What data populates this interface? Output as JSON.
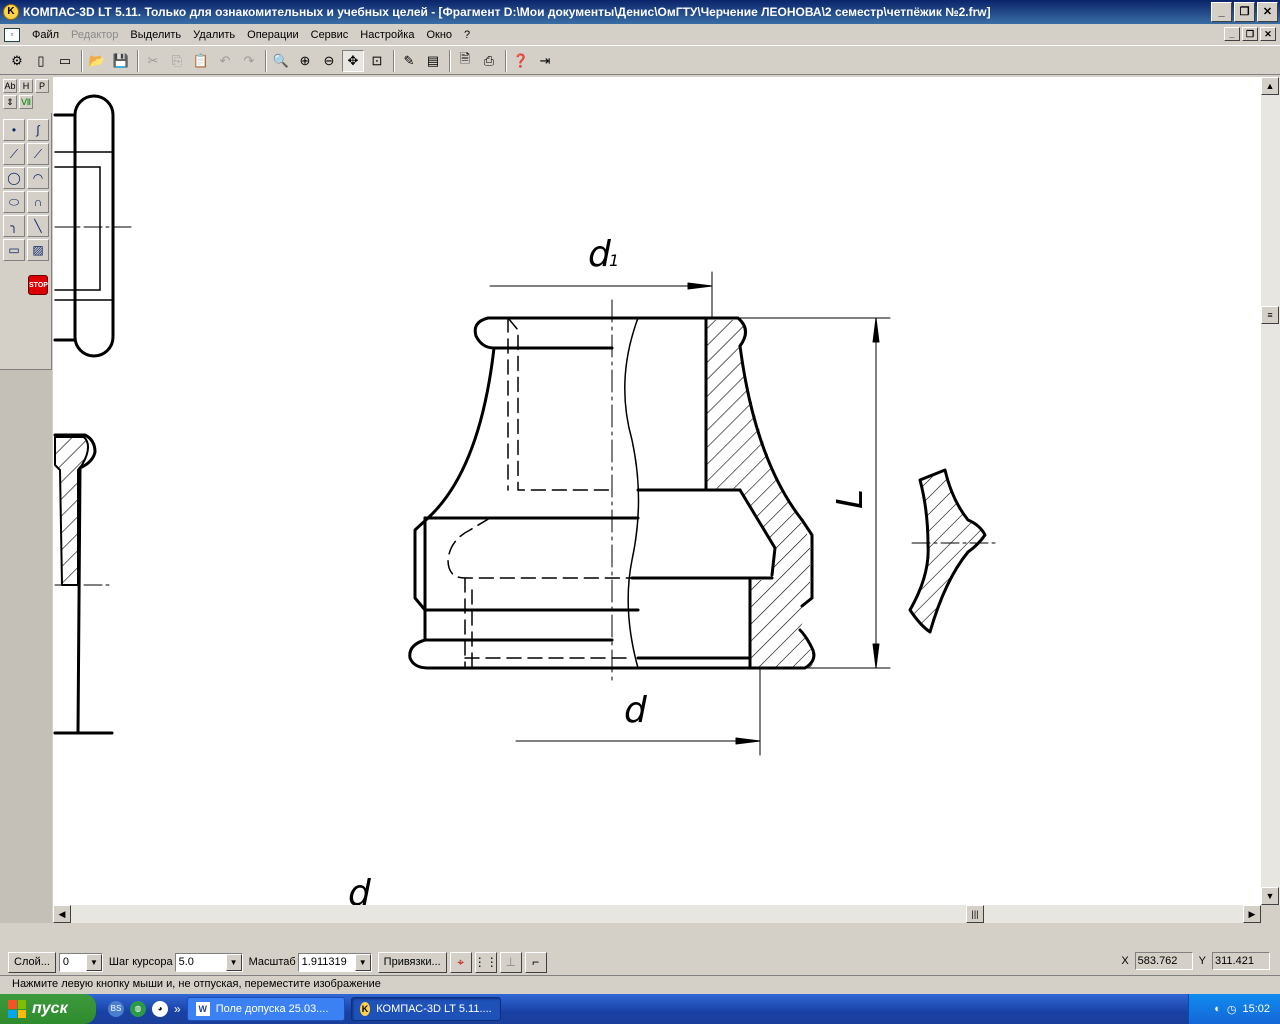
{
  "window": {
    "title": "КОМПАС-3D LT 5.11. Только для ознакомительных и учебных целей - [Фрагмент D:\\Мои документы\\Денис\\ОмГТУ\\Черчение ЛЕОНОВА\\2 семестр\\четпёжик №2.frw]",
    "minimize": "_",
    "restore": "❐",
    "close": "✕"
  },
  "menu": {
    "items": [
      {
        "label": "Файл",
        "disabled": false
      },
      {
        "label": "Редактор",
        "disabled": true
      },
      {
        "label": "Выделить",
        "disabled": false
      },
      {
        "label": "Удалить",
        "disabled": false
      },
      {
        "label": "Операции",
        "disabled": false
      },
      {
        "label": "Сервис",
        "disabled": false
      },
      {
        "label": "Настройка",
        "disabled": false
      },
      {
        "label": "Окно",
        "disabled": false
      },
      {
        "label": "?",
        "disabled": false
      }
    ]
  },
  "toolbar": {
    "icons": [
      "settings-icon",
      "new-sheet-icon",
      "new-fragment-icon",
      "open-icon",
      "save-icon",
      "cut-icon",
      "copy-icon",
      "paste-icon",
      "undo-icon",
      "redo-icon",
      "zoom-window-icon",
      "zoom-in-icon",
      "zoom-out-icon",
      "pan-icon",
      "zoom-all-icon",
      "properties-icon",
      "layers-icon",
      "preview-icon",
      "print-icon",
      "help-icon",
      "exit-icon"
    ]
  },
  "left_tabs": [
    "Ab",
    "H",
    "P"
  ],
  "drawing": {
    "label_d1": "d",
    "label_d1_sub": "1",
    "label_d": "d",
    "label_L": "L",
    "label_d_bottom": "d"
  },
  "status": {
    "layer_label": "Слой...",
    "layer_value": "0",
    "step_label": "Шаг курсора",
    "step_value": "5.0",
    "scale_label": "Масштаб",
    "scale_value": "1.911319",
    "snap_label": "Привязки...",
    "x_label": "X",
    "x_value": "583.762",
    "y_label": "Y",
    "y_value": "311.421"
  },
  "hint": "Нажмите левую кнопку мыши и, не отпуская, переместите изображение",
  "taskbar": {
    "start": "пуск",
    "task1": "Поле допуска 25.03....",
    "task2": "КОМПАС-3D LT 5.11....",
    "clock": "15:02"
  }
}
